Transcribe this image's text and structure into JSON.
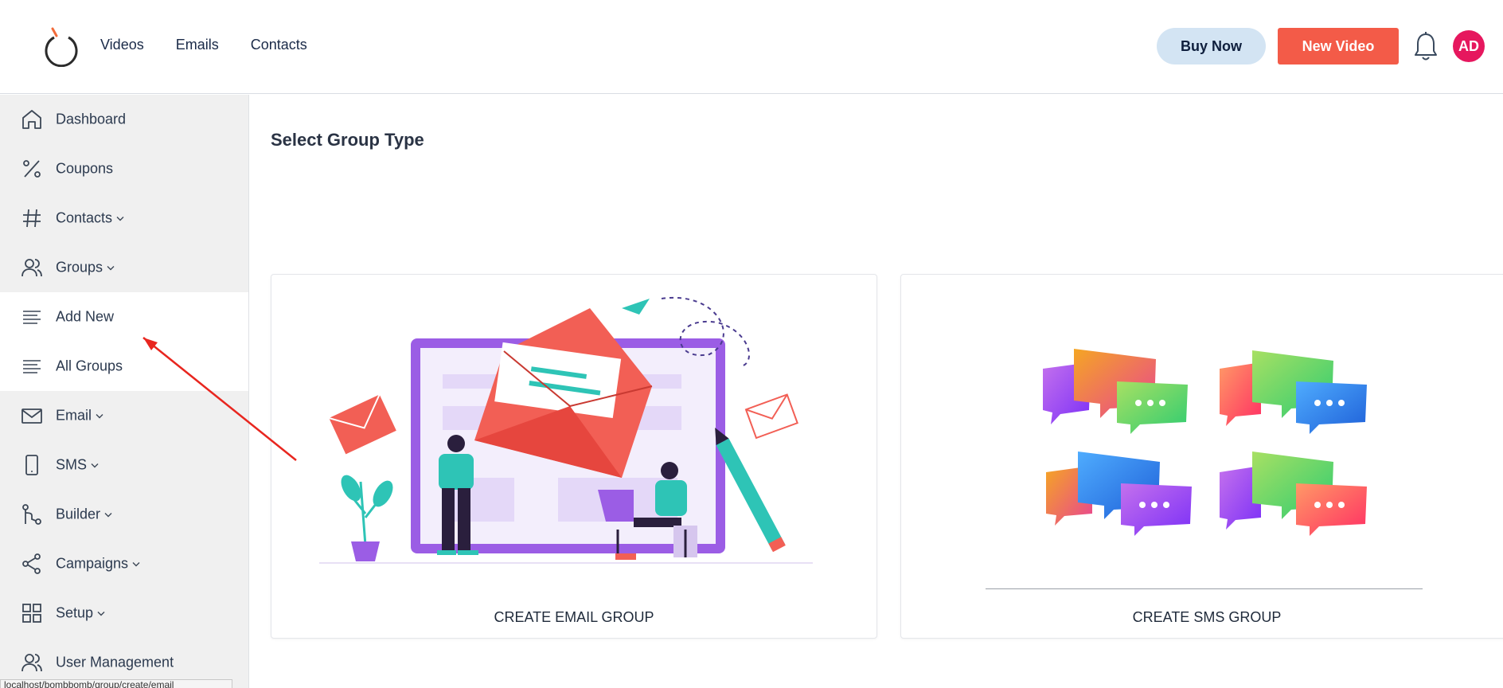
{
  "header": {
    "nav": [
      "Videos",
      "Emails",
      "Contacts"
    ],
    "buy_label": "Buy Now",
    "new_video_label": "New Video",
    "avatar_initials": "AD",
    "colors": {
      "buy_bg": "#d3e4f3",
      "new_video_bg": "#f35b48",
      "avatar_bg": "#e6175e"
    }
  },
  "sidebar": {
    "items": [
      {
        "label": "Dashboard",
        "icon": "home-icon"
      },
      {
        "label": "Coupons",
        "icon": "percent-icon"
      },
      {
        "label": "Contacts",
        "icon": "hash-icon",
        "expandable": true
      },
      {
        "label": "Groups",
        "icon": "users-icon",
        "expandable": true
      },
      {
        "label": "Add New",
        "icon": "list-icon",
        "submenu": true
      },
      {
        "label": "All Groups",
        "icon": "list-icon",
        "submenu": true
      },
      {
        "label": "Email",
        "icon": "mail-icon",
        "expandable": true
      },
      {
        "label": "SMS",
        "icon": "phone-icon",
        "expandable": true
      },
      {
        "label": "Builder",
        "icon": "git-branch-icon",
        "expandable": true
      },
      {
        "label": "Campaigns",
        "icon": "share-icon",
        "expandable": true
      },
      {
        "label": "Setup",
        "icon": "grid-icon",
        "expandable": true
      },
      {
        "label": "User Management",
        "icon": "users-icon"
      }
    ]
  },
  "status_url": "localhost/bombbomb/group/create/email",
  "main": {
    "title": "Select Group Type",
    "cards": [
      {
        "caption": "CREATE EMAIL GROUP",
        "illustration": "email-envelope-illustration"
      },
      {
        "caption": "CREATE SMS GROUP",
        "illustration": "chat-bubbles-illustration"
      }
    ]
  }
}
